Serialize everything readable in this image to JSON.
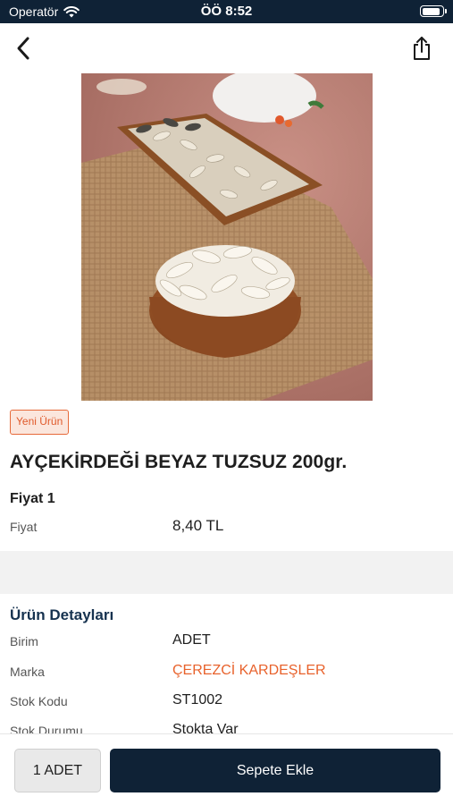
{
  "status_bar": {
    "carrier": "Operatör",
    "time": "ÖÖ 8:52",
    "battery_level": 0.92
  },
  "nav": {
    "back_icon": "chevron-left-icon",
    "share_icon": "share-icon"
  },
  "product": {
    "badge": "Yeni Ürün",
    "title": "AYÇEKİRDEĞİ BEYAZ TUZSUZ 200gr.",
    "image_icon": "product-photo"
  },
  "price": {
    "section_title": "Fiyat 1",
    "label": "Fiyat",
    "value": "8,40 TL"
  },
  "details": {
    "title": "Ürün Detayları",
    "rows": [
      {
        "label": "Birim",
        "value": "ADET"
      },
      {
        "label": "Marka",
        "value": "ÇEREZCİ KARDEŞLER"
      },
      {
        "label": "Stok Kodu",
        "value": "ST1002"
      },
      {
        "label": "Stok Durumu",
        "value": "Stokta Var"
      }
    ]
  },
  "bottom_bar": {
    "quantity_label": "1 ADET",
    "add_to_cart_label": "Sepete Ekle"
  },
  "colors": {
    "primary": "#0f2236",
    "accent": "#e8622c",
    "badge_bg": "#fbe6dd"
  }
}
